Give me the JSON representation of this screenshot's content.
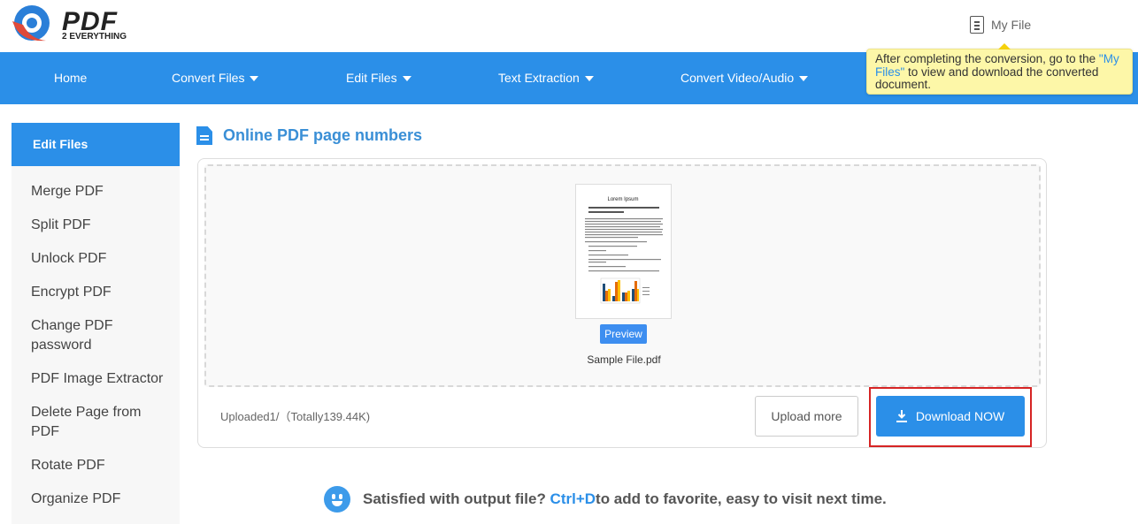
{
  "header": {
    "logo_main": "PDF",
    "logo_sub": "2 EVERYTHING",
    "my_file_label": "My File"
  },
  "tooltip": {
    "text_before": "After completing the conversion, go to the ",
    "link": "\"My Files\"",
    "text_after": " to view and download the converted document."
  },
  "nav": {
    "items": [
      {
        "label": "Home",
        "has_dropdown": false
      },
      {
        "label": "Convert Files",
        "has_dropdown": true
      },
      {
        "label": "Edit Files",
        "has_dropdown": true
      },
      {
        "label": "Text Extraction",
        "has_dropdown": true
      },
      {
        "label": "Convert Video/Audio",
        "has_dropdown": true
      }
    ]
  },
  "sidebar": {
    "heading": "Edit Files",
    "items": [
      {
        "label": "Merge PDF"
      },
      {
        "label": "Split PDF"
      },
      {
        "label": "Unlock PDF"
      },
      {
        "label": "Encrypt PDF"
      },
      {
        "label": "Change PDF password"
      },
      {
        "label": "PDF Image Extractor"
      },
      {
        "label": "Delete Page from PDF"
      },
      {
        "label": "Rotate PDF"
      },
      {
        "label": "Organize PDF"
      }
    ]
  },
  "main": {
    "title": "Online PDF page numbers",
    "file": {
      "name": "Sample File.pdf",
      "thumb_title": "Lorem Ipsum",
      "preview_label": "Preview"
    },
    "status": "Uploaded1/（Totally139.44K)",
    "upload_more_label": "Upload more",
    "download_label": "Download NOW"
  },
  "footer": {
    "text_before": "Satisfied with output file? ",
    "shortcut": "Ctrl+D",
    "text_after": "to add to favorite, easy to visit next time."
  },
  "colors": {
    "brand_blue": "#2b8fe8",
    "tooltip_yellow": "#fdf7a8",
    "highlight_red": "#d62424"
  }
}
